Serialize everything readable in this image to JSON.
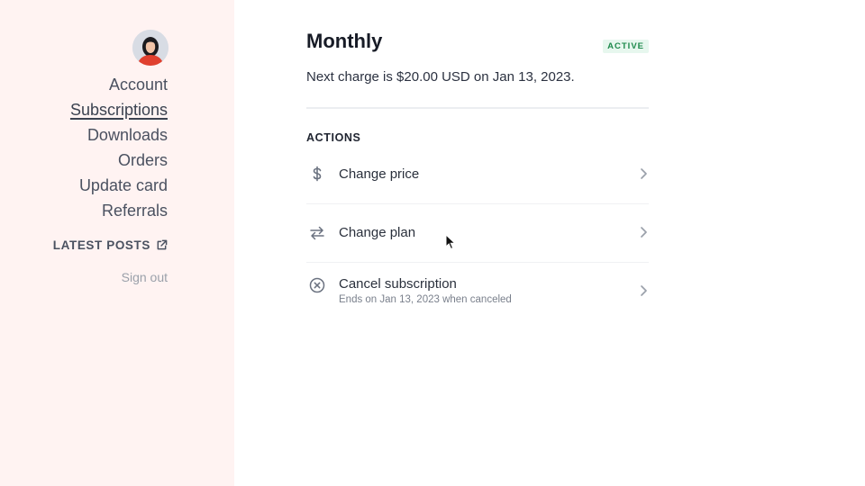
{
  "sidebar": {
    "nav_items": [
      {
        "label": "Account"
      },
      {
        "label": "Subscriptions",
        "active": true
      },
      {
        "label": "Downloads"
      },
      {
        "label": "Orders"
      },
      {
        "label": "Update card"
      },
      {
        "label": "Referrals"
      }
    ],
    "latest_posts_label": "LATEST POSTS",
    "sign_out_label": "Sign out"
  },
  "subscription": {
    "plan_name": "Monthly",
    "status_badge": "ACTIVE",
    "next_charge_text": "Next charge is $20.00 USD on Jan 13, 2023."
  },
  "actions": {
    "heading": "ACTIONS",
    "items": [
      {
        "label": "Change price",
        "icon": "dollar-icon"
      },
      {
        "label": "Change plan",
        "icon": "swap-arrows-icon"
      },
      {
        "label": "Cancel subscription",
        "sublabel": "Ends on Jan 13, 2023 when canceled",
        "icon": "cancel-circle-icon"
      }
    ]
  },
  "colors": {
    "sidebar_bg": "#fff3f2",
    "badge_bg": "#e7f7ee",
    "badge_text": "#1e8a4c"
  }
}
